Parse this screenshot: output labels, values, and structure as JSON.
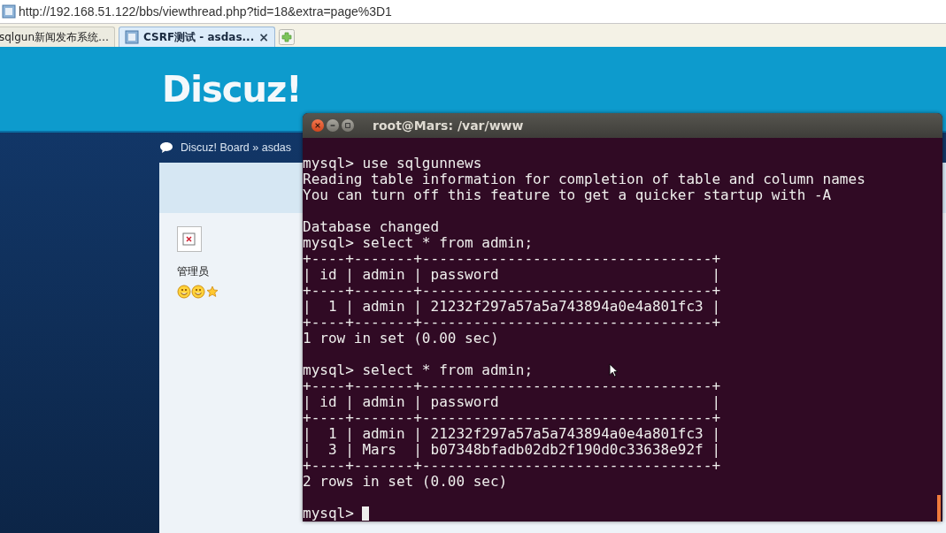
{
  "address_bar": {
    "url": "http://192.168.51.122/bbs/viewthread.php?tid=18&extra=page%3D1"
  },
  "tabs": [
    {
      "label": "sqlgun新闻发布系统…",
      "selected": false
    },
    {
      "label": "CSRF测试 - asdas...",
      "selected": true,
      "close": "×"
    }
  ],
  "page": {
    "logo": "Discuz!",
    "breadcrumb": "Discuz! Board » asdas",
    "author_role": "管理员"
  },
  "terminal": {
    "title": "root@Mars: /var/www",
    "prompt": "mysql> ",
    "blocks": [
      [
        "mysql> use sqlgunnews",
        "Reading table information for completion of table and column names",
        "You can turn off this feature to get a quicker startup with -A"
      ],
      [
        "Database changed",
        "mysql> select * from admin;",
        "+----+-------+----------------------------------+",
        "| id | admin | password                         |",
        "+----+-------+----------------------------------+",
        "|  1 | admin | 21232f297a57a5a743894a0e4a801fc3 |",
        "+----+-------+----------------------------------+",
        "1 row in set (0.00 sec)"
      ],
      [
        "mysql> select * from admin;",
        "+----+-------+----------------------------------+",
        "| id | admin | password                         |",
        "+----+-------+----------------------------------+",
        "|  1 | admin | 21232f297a57a5a743894a0e4a801fc3 |",
        "|  3 | Mars  | b07348bfadb02db2f190d0c33638e92f |",
        "+----+-------+----------------------------------+",
        "2 rows in set (0.00 sec)"
      ]
    ]
  }
}
